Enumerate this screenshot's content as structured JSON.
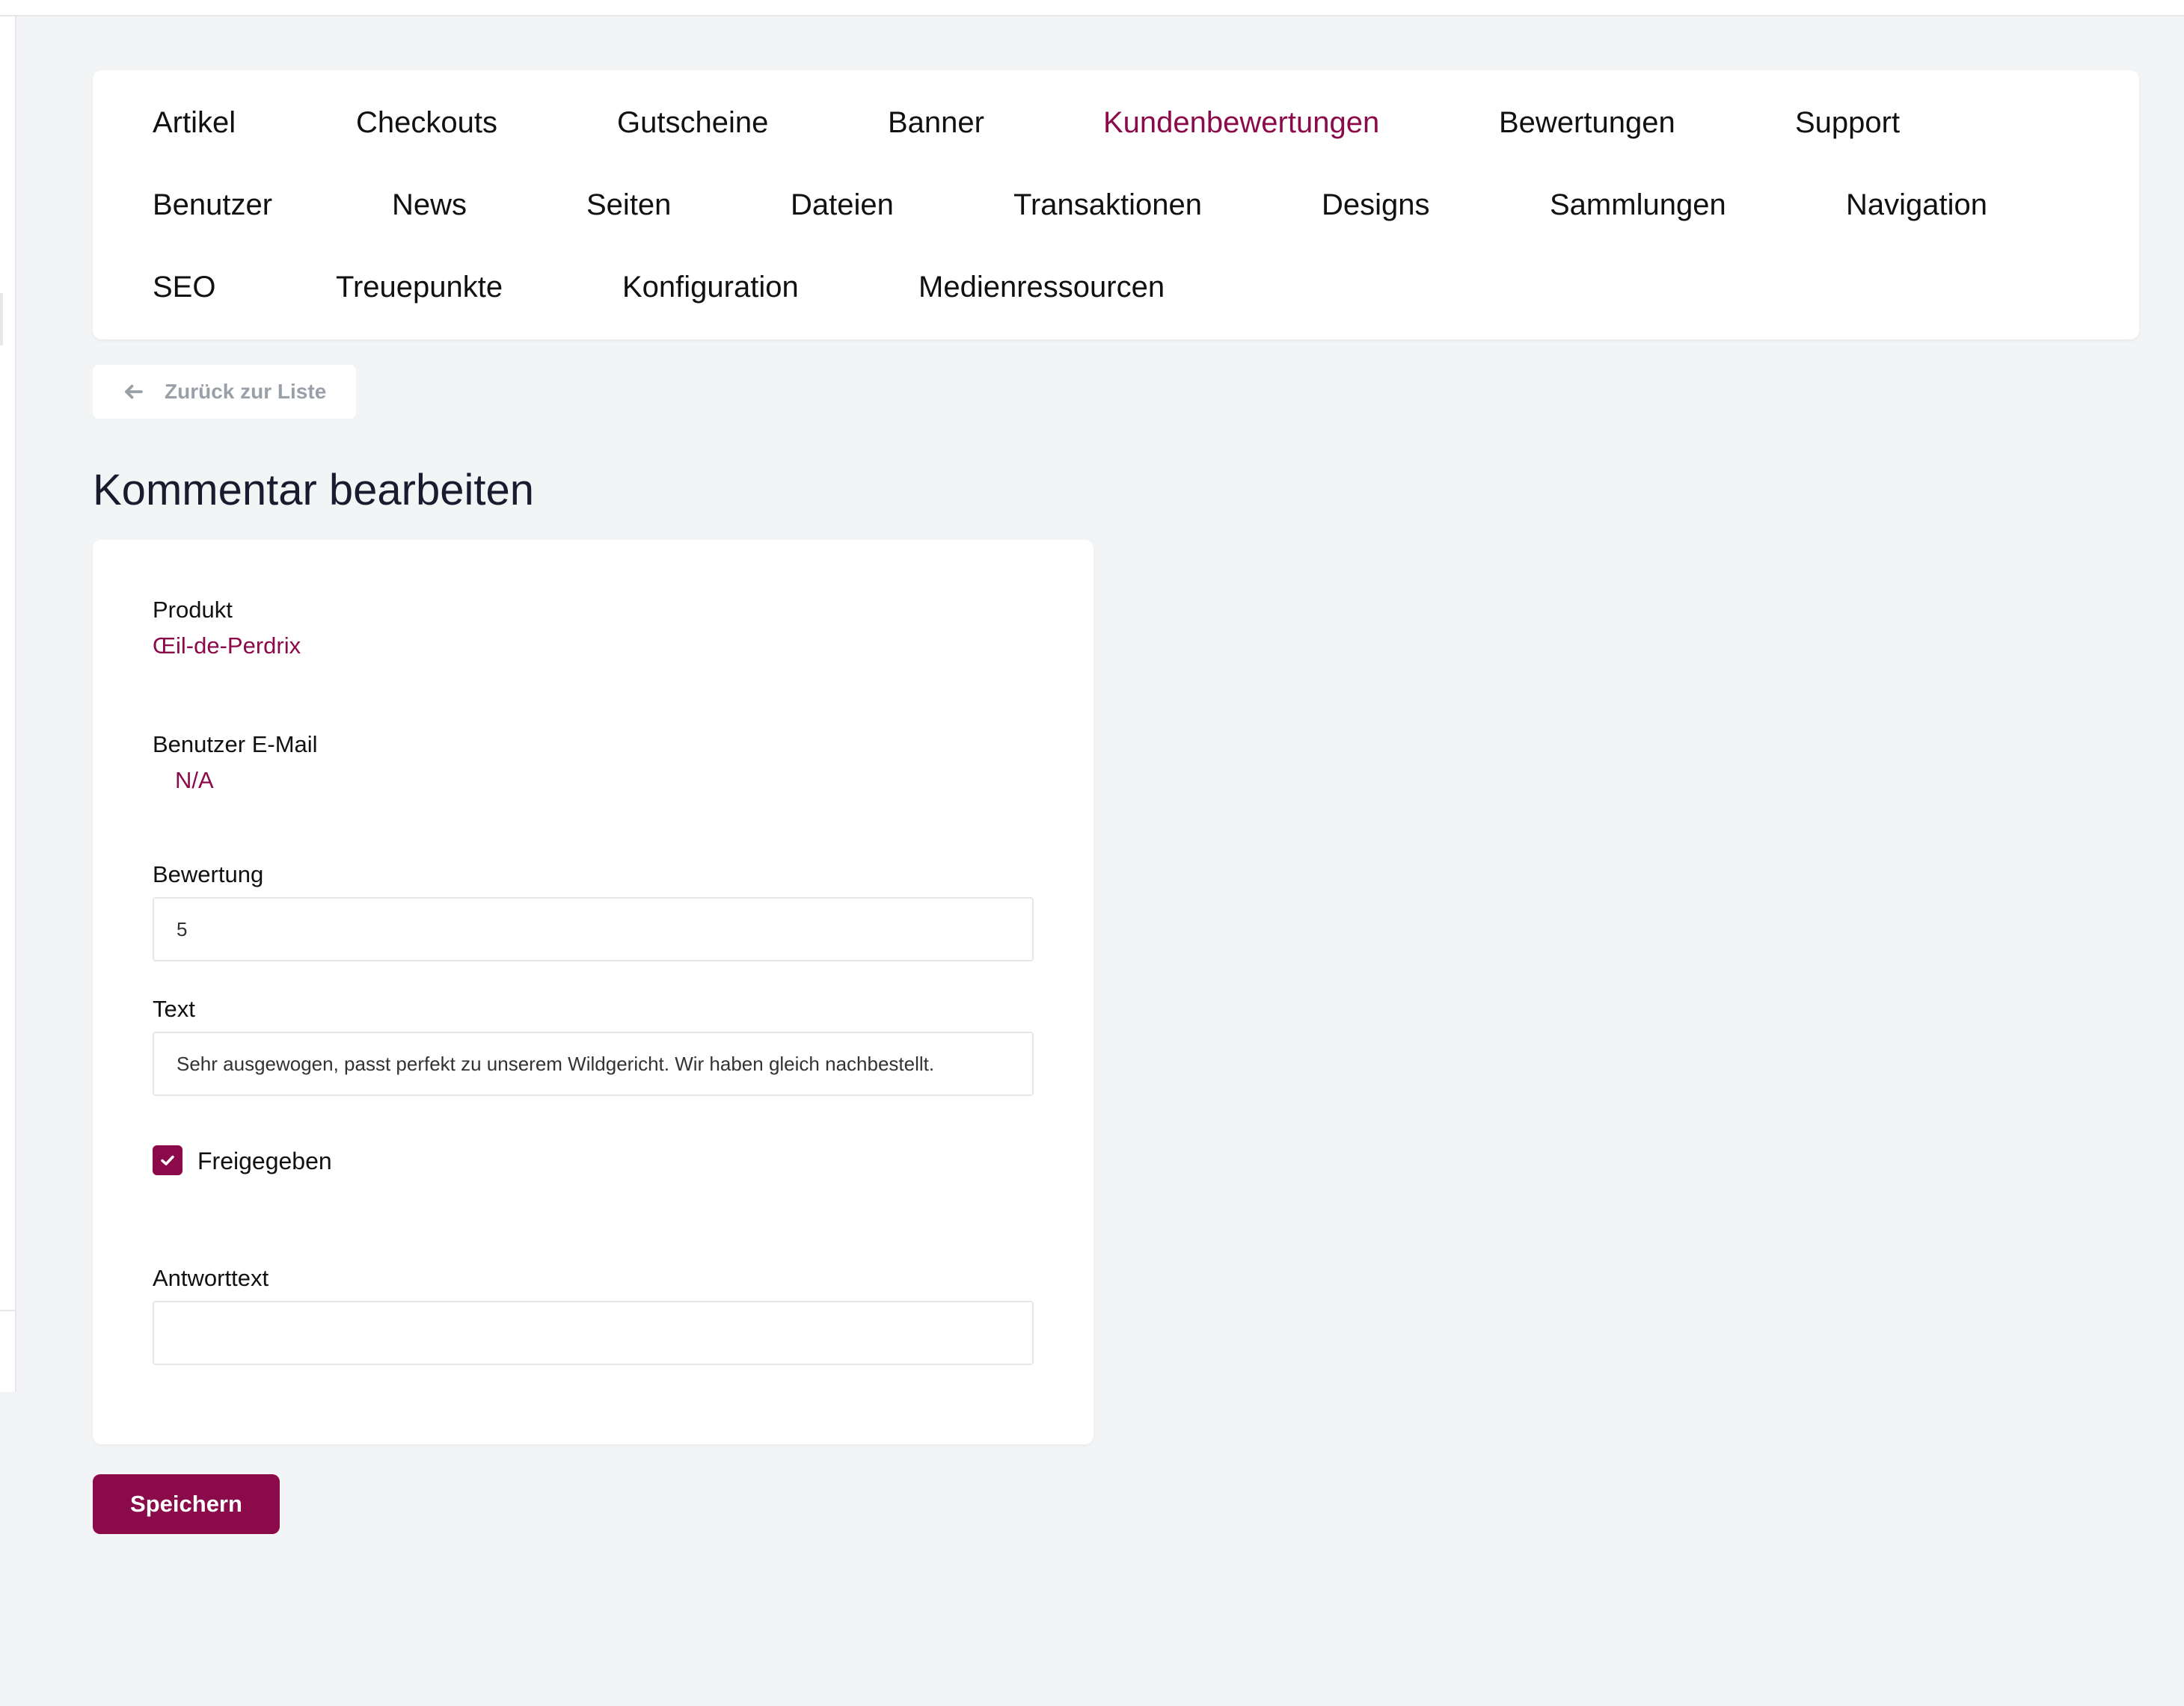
{
  "nav": {
    "rows": [
      [
        {
          "label": "Artikel",
          "active": false
        },
        {
          "label": "Checkouts",
          "active": false
        },
        {
          "label": "Gutscheine",
          "active": false
        },
        {
          "label": "Banner",
          "active": false
        },
        {
          "label": "Kundenbewertungen",
          "active": true
        },
        {
          "label": "Bewertungen",
          "active": false
        },
        {
          "label": "Support",
          "active": false
        }
      ],
      [
        {
          "label": "Benutzer",
          "active": false
        },
        {
          "label": "News",
          "active": false
        },
        {
          "label": "Seiten",
          "active": false
        },
        {
          "label": "Dateien",
          "active": false
        },
        {
          "label": "Transaktionen",
          "active": false
        },
        {
          "label": "Designs",
          "active": false
        },
        {
          "label": "Sammlungen",
          "active": false
        },
        {
          "label": "Navigation",
          "active": false
        }
      ],
      [
        {
          "label": "SEO",
          "active": false
        },
        {
          "label": "Treuepunkte",
          "active": false
        },
        {
          "label": "Konfiguration",
          "active": false
        },
        {
          "label": "Medienressourcen",
          "active": false
        }
      ]
    ]
  },
  "back_button": {
    "label": "Zurück zur Liste",
    "icon": "arrow-left-icon"
  },
  "page_title": "Kommentar bearbeiten",
  "form": {
    "product": {
      "label": "Produkt",
      "value": "Œil-de-Perdrix"
    },
    "user_email": {
      "label": "Benutzer E-Mail",
      "value": "N/A"
    },
    "rating": {
      "label": "Bewertung",
      "value": "5"
    },
    "text": {
      "label": "Text",
      "value": "Sehr ausgewogen, passt perfekt zu unserem Wildgericht. Wir haben gleich nachbestellt."
    },
    "approved": {
      "label": "Freigegeben",
      "checked": true,
      "icon": "checkmark-icon"
    },
    "reply": {
      "label": "Antworttext",
      "value": ""
    }
  },
  "save_button": {
    "label": "Speichern"
  },
  "colors": {
    "accent": "#8b0a4a",
    "background": "#f3f4f6",
    "card": "#ffffff",
    "muted": "#9aa0a8"
  }
}
